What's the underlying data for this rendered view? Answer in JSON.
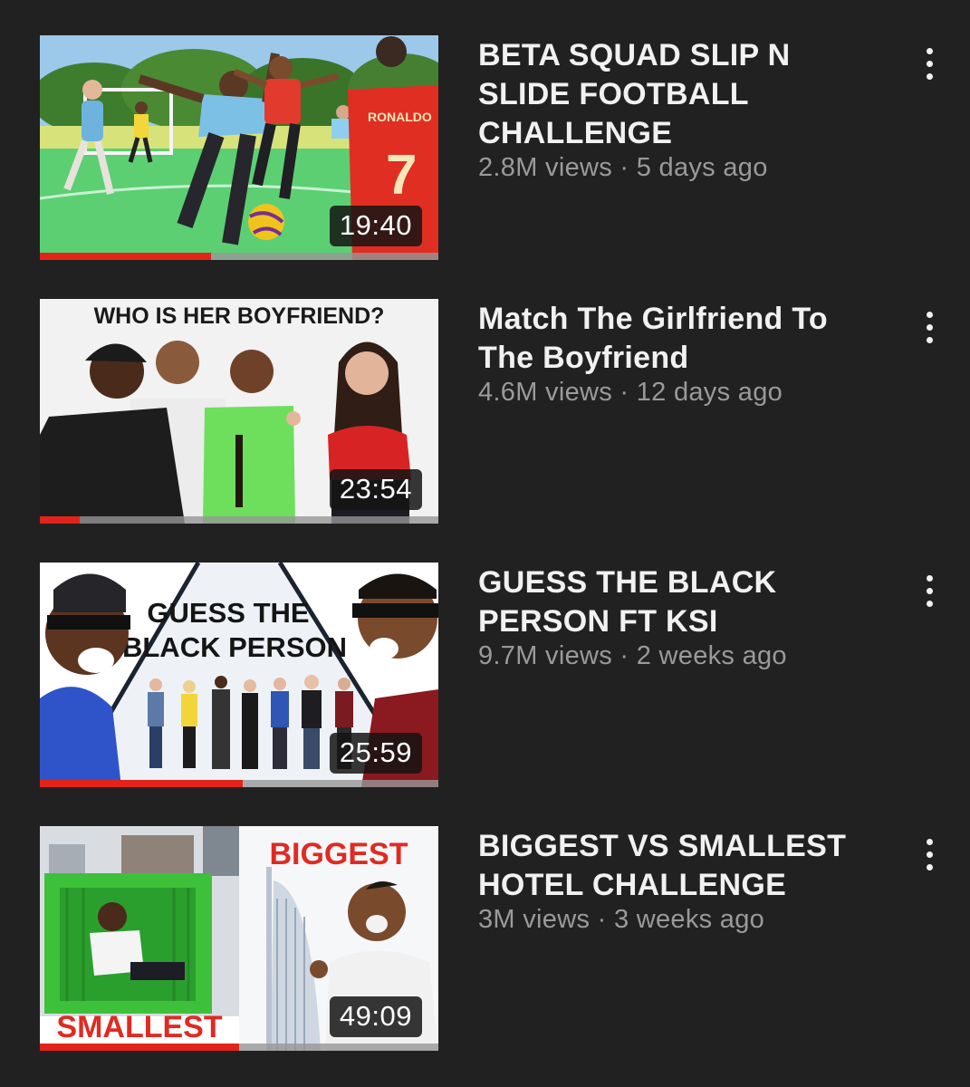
{
  "videos": [
    {
      "title": "BETA SQUAD SLIP N SLIDE FOOTBALL CHALLENGE",
      "views": "2.8M views",
      "separator": "·",
      "age": "5 days ago",
      "duration": "19:40",
      "progress": 0.43,
      "thumbnail_text": "RONALDO",
      "jersey_number": "7",
      "menu_icon": "more-vert-icon"
    },
    {
      "title": "Match The Girlfriend To The Boyfriend",
      "views": "4.6M views",
      "separator": "·",
      "age": "12 days ago",
      "duration": "23:54",
      "progress": 0.1,
      "thumbnail_text": "WHO IS HER BOYFRIEND?",
      "menu_icon": "more-vert-icon"
    },
    {
      "title": "GUESS THE BLACK PERSON FT KSI",
      "views": "9.7M views",
      "separator": "·",
      "age": "2 weeks ago",
      "duration": "25:59",
      "progress": 0.51,
      "thumbnail_text_line1": "GUESS THE",
      "thumbnail_text_line2": "BLACK PERSON",
      "menu_icon": "more-vert-icon"
    },
    {
      "title": "BIGGEST VS SMALLEST HOTEL CHALLENGE",
      "views": "3M views",
      "separator": "·",
      "age": "3 weeks ago",
      "duration": "49:09",
      "progress": 0.5,
      "thumbnail_text_top": "BIGGEST",
      "thumbnail_text_bottom": "SMALLEST",
      "menu_icon": "more-vert-icon"
    }
  ],
  "colors": {
    "background": "#212121",
    "title": "#f1f1f1",
    "meta": "#9a9a9a",
    "progress": "#e2231a"
  }
}
